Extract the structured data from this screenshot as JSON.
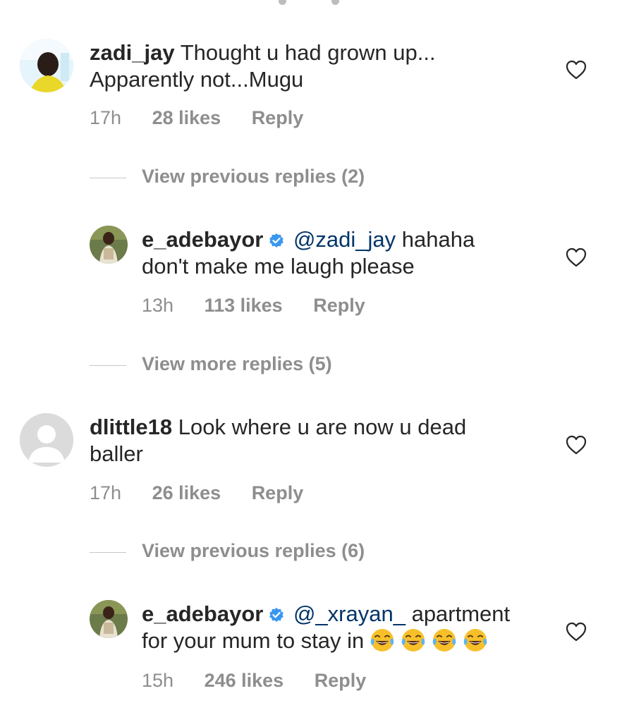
{
  "comments": [
    {
      "username": "zadi_jay",
      "text_line1": "Thought u had grown up...",
      "text_line2": "Apparently not...Mugu",
      "time": "17h",
      "likes": "28 likes",
      "reply": "Reply"
    },
    {
      "username": "e_adebayor",
      "mention": "@zadi_jay",
      "text_line1": "hahaha",
      "text_line2": "don't make me laugh please",
      "time": "13h",
      "likes": "113 likes",
      "reply": "Reply"
    },
    {
      "username": "dlittle18",
      "text_line1": "Look where u are now u dead",
      "text_line2": "baller",
      "time": "17h",
      "likes": "26 likes",
      "reply": "Reply"
    },
    {
      "username": "e_adebayor",
      "mention": "@_xrayan_",
      "text_line1": "apartment",
      "text_line2": "for your mum to stay in",
      "emojis": [
        "tears-of-joy",
        "tears-of-joy",
        "tears-of-joy",
        "tears-of-joy"
      ],
      "time": "15h",
      "likes": "246 likes",
      "reply": "Reply"
    }
  ],
  "view_links": [
    "View previous replies (2)",
    "View more replies (5)",
    "View previous replies (6)"
  ],
  "icons": {
    "like": "heart-outline-icon",
    "verified": "verified-badge-icon",
    "emoji": "face-with-tears-of-joy"
  },
  "colors": {
    "text": "#262626",
    "secondary": "#8e8e8e",
    "mention": "#003569",
    "verified": "#3897f0"
  }
}
